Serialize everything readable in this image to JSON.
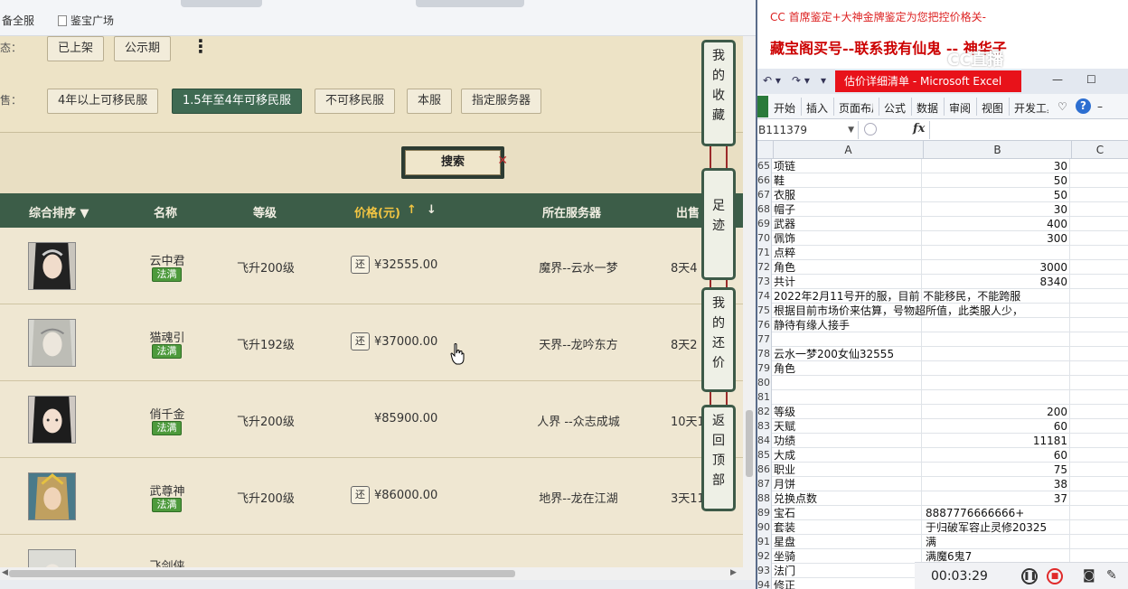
{
  "browser": {
    "bookmarks": [
      "备全服",
      "鉴宝广场"
    ],
    "filters": {
      "status_label": "态：",
      "status_buttons": [
        "已上架",
        "公示期"
      ],
      "migrate_label": "售：",
      "migrate_buttons": [
        "4年以上可移民服",
        "1.5年至4年可移民服",
        "不可移民服",
        "本服",
        "指定服务器"
      ],
      "active_migrate": "1.5年至4年可移民服"
    },
    "search_label": "搜索",
    "table_headers": {
      "sort": "综合排序 ▼",
      "name": "名称",
      "level": "等级",
      "price": "价格(元)",
      "price_up": "↑",
      "price_down": "↓",
      "server": "所在服务器",
      "time": "出售"
    },
    "rows": [
      {
        "name": "云中君",
        "badge": "法满",
        "level": "飞升200级",
        "price_icon": "还",
        "price": "¥32555.00",
        "server": "魔界--云水一梦",
        "time": "8天4"
      },
      {
        "name": "猫魂引",
        "badge": "法满",
        "level": "飞升192级",
        "price_icon": "还",
        "price": "¥37000.00",
        "server": "天界--龙吟东方",
        "time": "8天2"
      },
      {
        "name": "俏千金",
        "badge": "法满",
        "level": "飞升200级",
        "price_icon": "",
        "price": "¥85900.00",
        "server": "人界 --众志成城",
        "time": "10天1"
      },
      {
        "name": "武尊神",
        "badge": "法满",
        "level": "飞升200级",
        "price_icon": "还",
        "price": "¥86000.00",
        "server": "地界--龙在江湖",
        "time": "3天11"
      },
      {
        "name": "飞剑侠",
        "badge": "",
        "level": "",
        "price_icon": "",
        "price": "",
        "server": "",
        "time": ""
      }
    ],
    "side_panel": [
      {
        "label": "我的收藏",
        "chars": [
          "我",
          "的",
          "收",
          "藏"
        ]
      },
      {
        "label": "足迹",
        "chars": [
          "足",
          "迹"
        ]
      },
      {
        "label": "我的还价",
        "chars": [
          "我",
          "的",
          "还",
          "价"
        ]
      },
      {
        "label": "返回顶部",
        "chars": [
          "返",
          "回",
          "顶",
          "部"
        ]
      }
    ]
  },
  "overlay": {
    "line1": "CC 首席鉴定+大神金牌鉴定为您把控价格关-",
    "line2": "藏宝阁买号--联系我有仙鬼 -- 神华子",
    "watermark": "CC直播"
  },
  "excel": {
    "window_title": "估价详细清单 - Microsoft Excel",
    "ribbon_tabs": [
      "开始",
      "插入",
      "页面布局",
      "公式",
      "数据",
      "审阅",
      "视图",
      "开发工具"
    ],
    "name_box": "B111379",
    "fx": "fx",
    "columns": [
      "A",
      "B",
      "C"
    ],
    "rows": [
      {
        "rn": "65",
        "a": "项链",
        "b": "30",
        "bnum": true
      },
      {
        "rn": "66",
        "a": "鞋",
        "b": "50",
        "bnum": true
      },
      {
        "rn": "67",
        "a": "衣服",
        "b": "50",
        "bnum": true
      },
      {
        "rn": "68",
        "a": "帽子",
        "b": "30",
        "bnum": true
      },
      {
        "rn": "69",
        "a": "武器",
        "b": "400",
        "bnum": true
      },
      {
        "rn": "70",
        "a": "佩饰",
        "b": "300",
        "bnum": true
      },
      {
        "rn": "71",
        "a": "点粹",
        "b": "",
        "bnum": true
      },
      {
        "rn": "72",
        "a": "角色",
        "b": "3000",
        "bnum": true
      },
      {
        "rn": "73",
        "a": "共计",
        "b": "8340",
        "bnum": true
      },
      {
        "rn": "74",
        "a": "2022年2月11号开的服，目前 不能移民，不能跨服",
        "b": "",
        "bnum": true
      },
      {
        "rn": "75",
        "a": "根据目前市场价来估算，号物超所值，此类服人少，",
        "b": "",
        "bnum": true
      },
      {
        "rn": "76",
        "a": "静待有缘人接手",
        "b": "",
        "bnum": true
      },
      {
        "rn": "77",
        "a": "",
        "b": "",
        "bnum": true
      },
      {
        "rn": "78",
        "a": "云水一梦200女仙32555",
        "b": "",
        "bnum": true
      },
      {
        "rn": "79",
        "a": "角色",
        "b": "",
        "bnum": true
      },
      {
        "rn": "80",
        "a": "",
        "b": "",
        "bnum": true
      },
      {
        "rn": "81",
        "a": "",
        "b": "",
        "bnum": true
      },
      {
        "rn": "82",
        "a": "等级",
        "b": "200",
        "bnum": true
      },
      {
        "rn": "83",
        "a": "天赋",
        "b": "60",
        "bnum": true
      },
      {
        "rn": "84",
        "a": "功绩",
        "b": "11181",
        "bnum": true
      },
      {
        "rn": "85",
        "a": "大成",
        "b": "60",
        "bnum": true
      },
      {
        "rn": "86",
        "a": "职业",
        "b": "75",
        "bnum": true
      },
      {
        "rn": "87",
        "a": "月饼",
        "b": "38",
        "bnum": true
      },
      {
        "rn": "88",
        "a": "兑换点数",
        "b": "37",
        "bnum": true
      },
      {
        "rn": "89",
        "a": "宝石",
        "b": "8887776666666+",
        "bnum": false
      },
      {
        "rn": "90",
        "a": "套装",
        "b": "于归破军容止灵修20325",
        "bnum": false
      },
      {
        "rn": "91",
        "a": "星盘",
        "b": "满",
        "bnum": false
      },
      {
        "rn": "92",
        "a": "坐骑",
        "b": "满魔6鬼7",
        "bnum": false
      },
      {
        "rn": "93",
        "a": "法门",
        "b": "",
        "bnum": false
      },
      {
        "rn": "94",
        "a": "修正",
        "b": "",
        "bnum": false
      }
    ]
  },
  "recorder": {
    "time": "00:03:29"
  },
  "colors": {
    "accent_green": "#3c5d48",
    "excel_title_red": "#e8121a",
    "badge_green": "#4d9a3c"
  }
}
